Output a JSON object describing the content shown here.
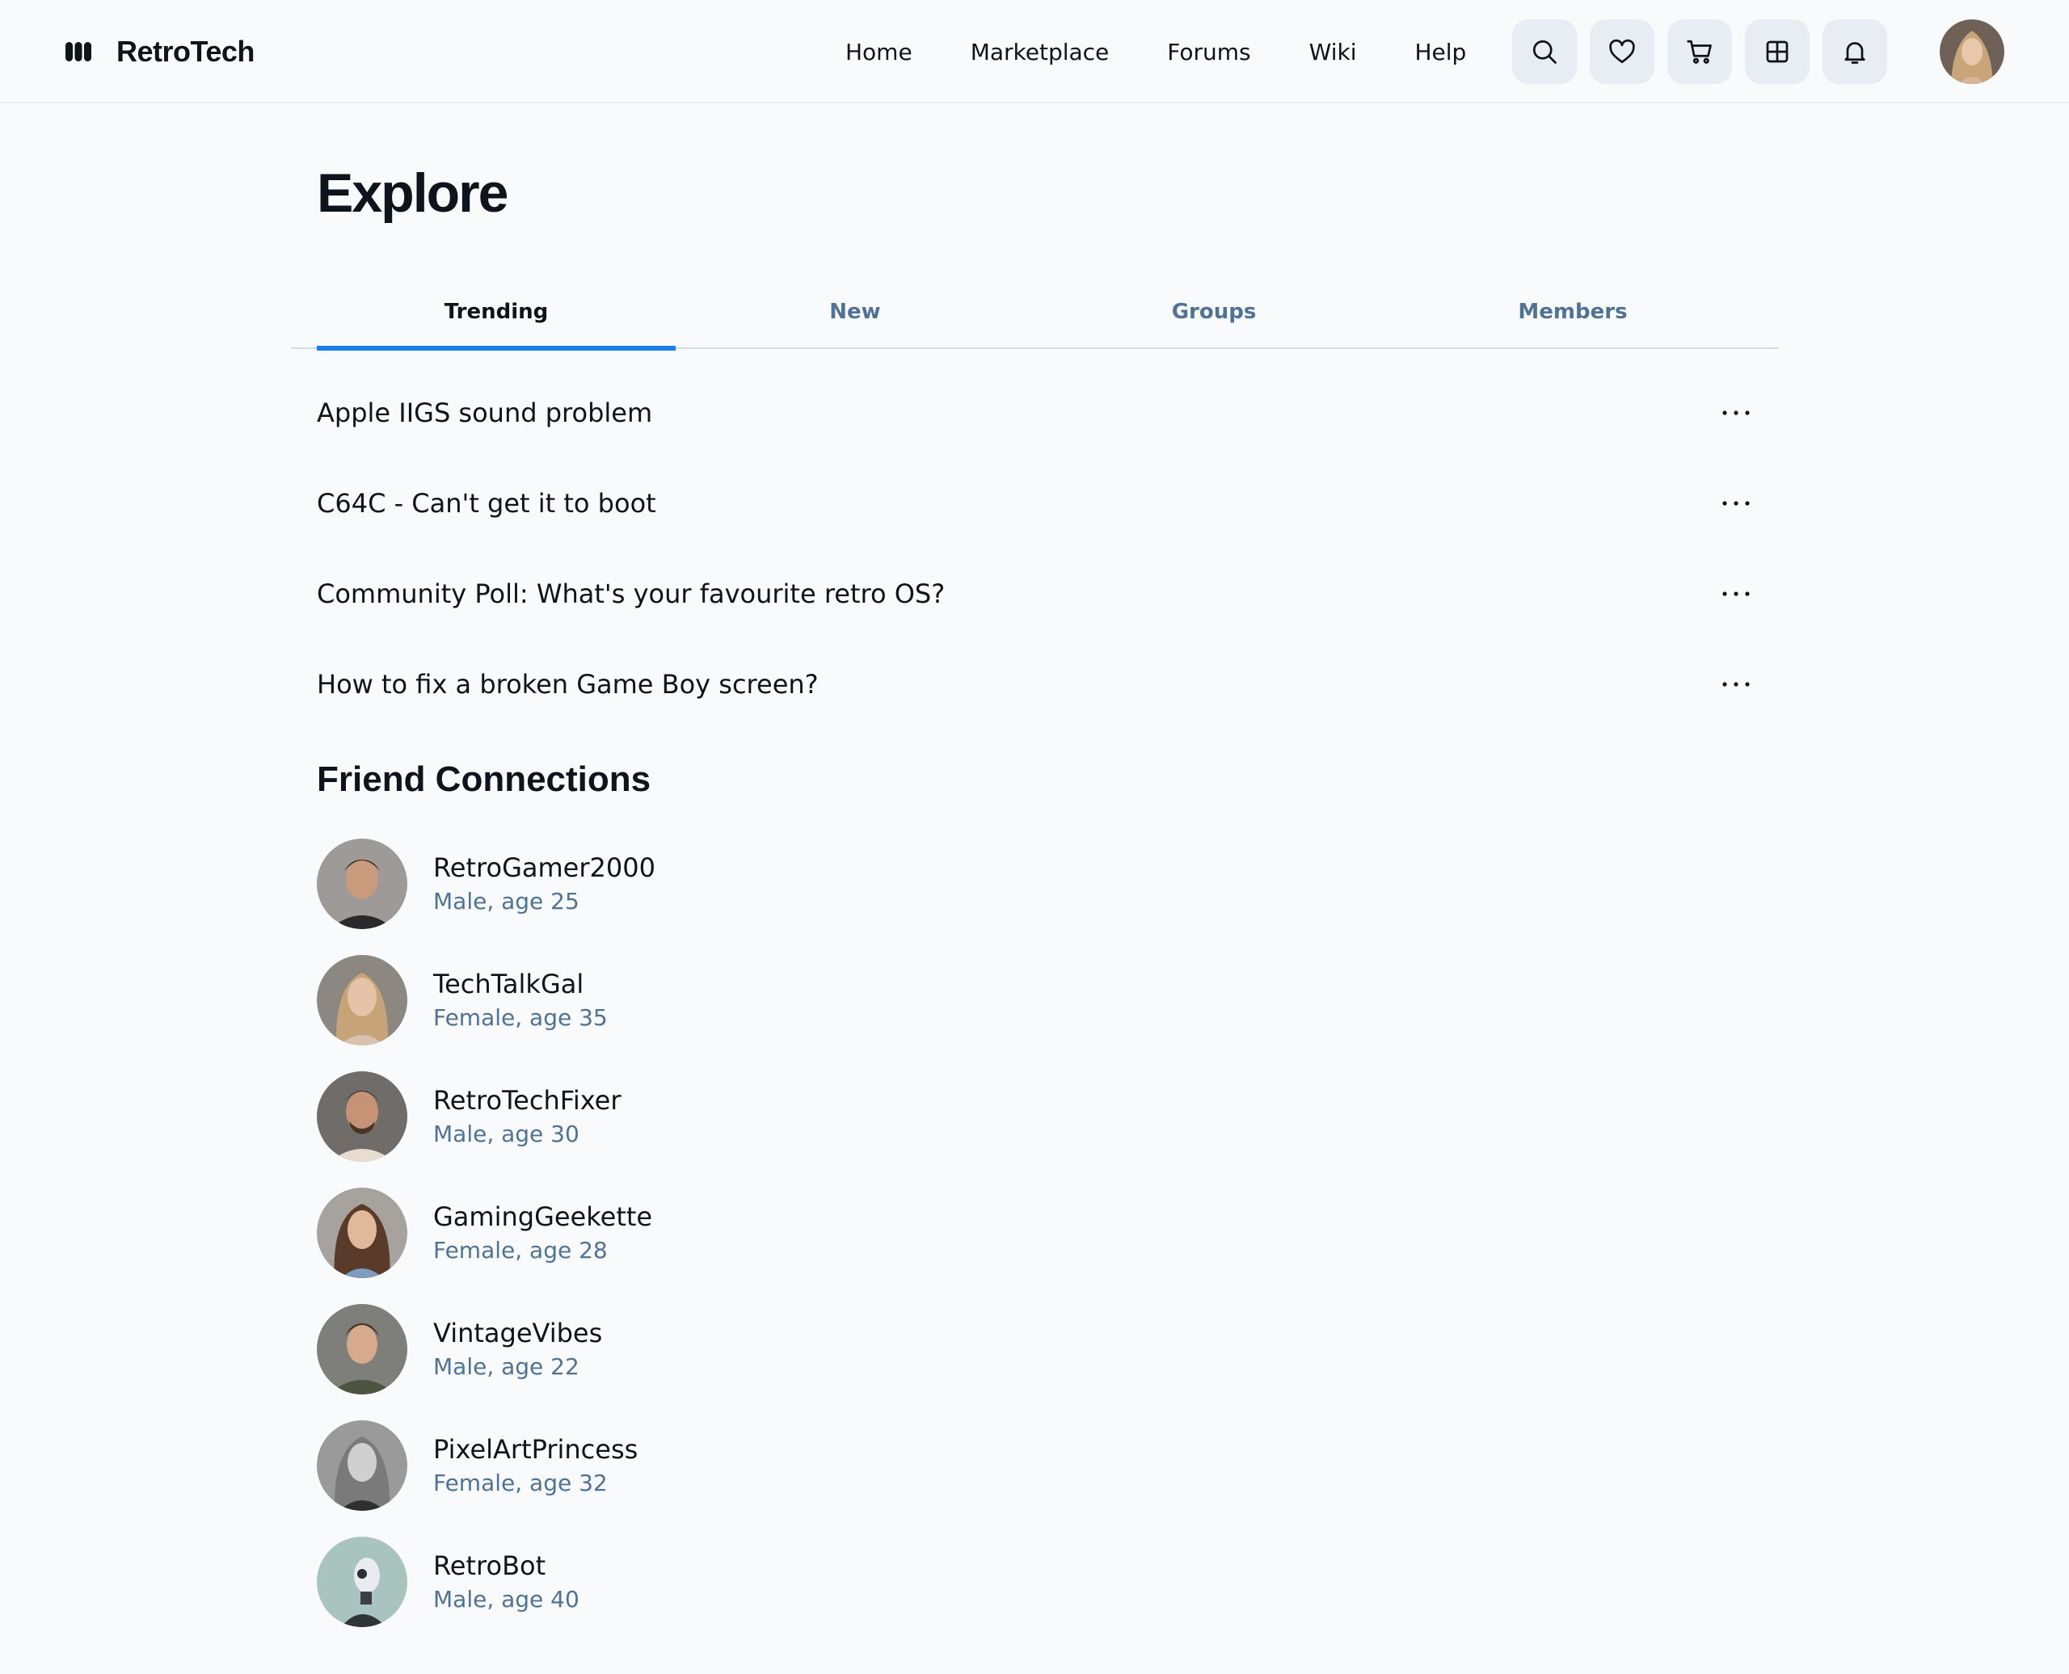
{
  "app": {
    "brand": "RetroTech",
    "nav": [
      "Home",
      "Marketplace",
      "Forums",
      "Wiki",
      "Help"
    ],
    "icons": [
      "search-icon",
      "heart-icon",
      "cart-icon",
      "grid-icon",
      "bell-icon"
    ],
    "accent_color": "#1980e6",
    "muted_color": "#4e7397"
  },
  "main": {
    "title": "Explore",
    "tabs": [
      "Trending",
      "New",
      "Groups",
      "Members"
    ],
    "active_tab": "Trending",
    "threads": [
      "Apple IIGS sound problem",
      "C64C - Can't get it to boot",
      "Community Poll: What's your favourite retro OS?",
      "How to fix a broken Game Boy screen?"
    ],
    "friends_title": "Friend Connections",
    "friends": [
      {
        "name": "RetroGamer2000",
        "meta": "Male, age 25"
      },
      {
        "name": "TechTalkGal",
        "meta": "Female, age 35"
      },
      {
        "name": "RetroTechFixer",
        "meta": "Male, age 30"
      },
      {
        "name": "GamingGeekette",
        "meta": "Female, age 28"
      },
      {
        "name": "VintageVibes",
        "meta": "Male, age 22"
      },
      {
        "name": "PixelArtPrincess",
        "meta": "Female, age 32"
      },
      {
        "name": "RetroBot",
        "meta": "Male, age 40"
      }
    ]
  }
}
